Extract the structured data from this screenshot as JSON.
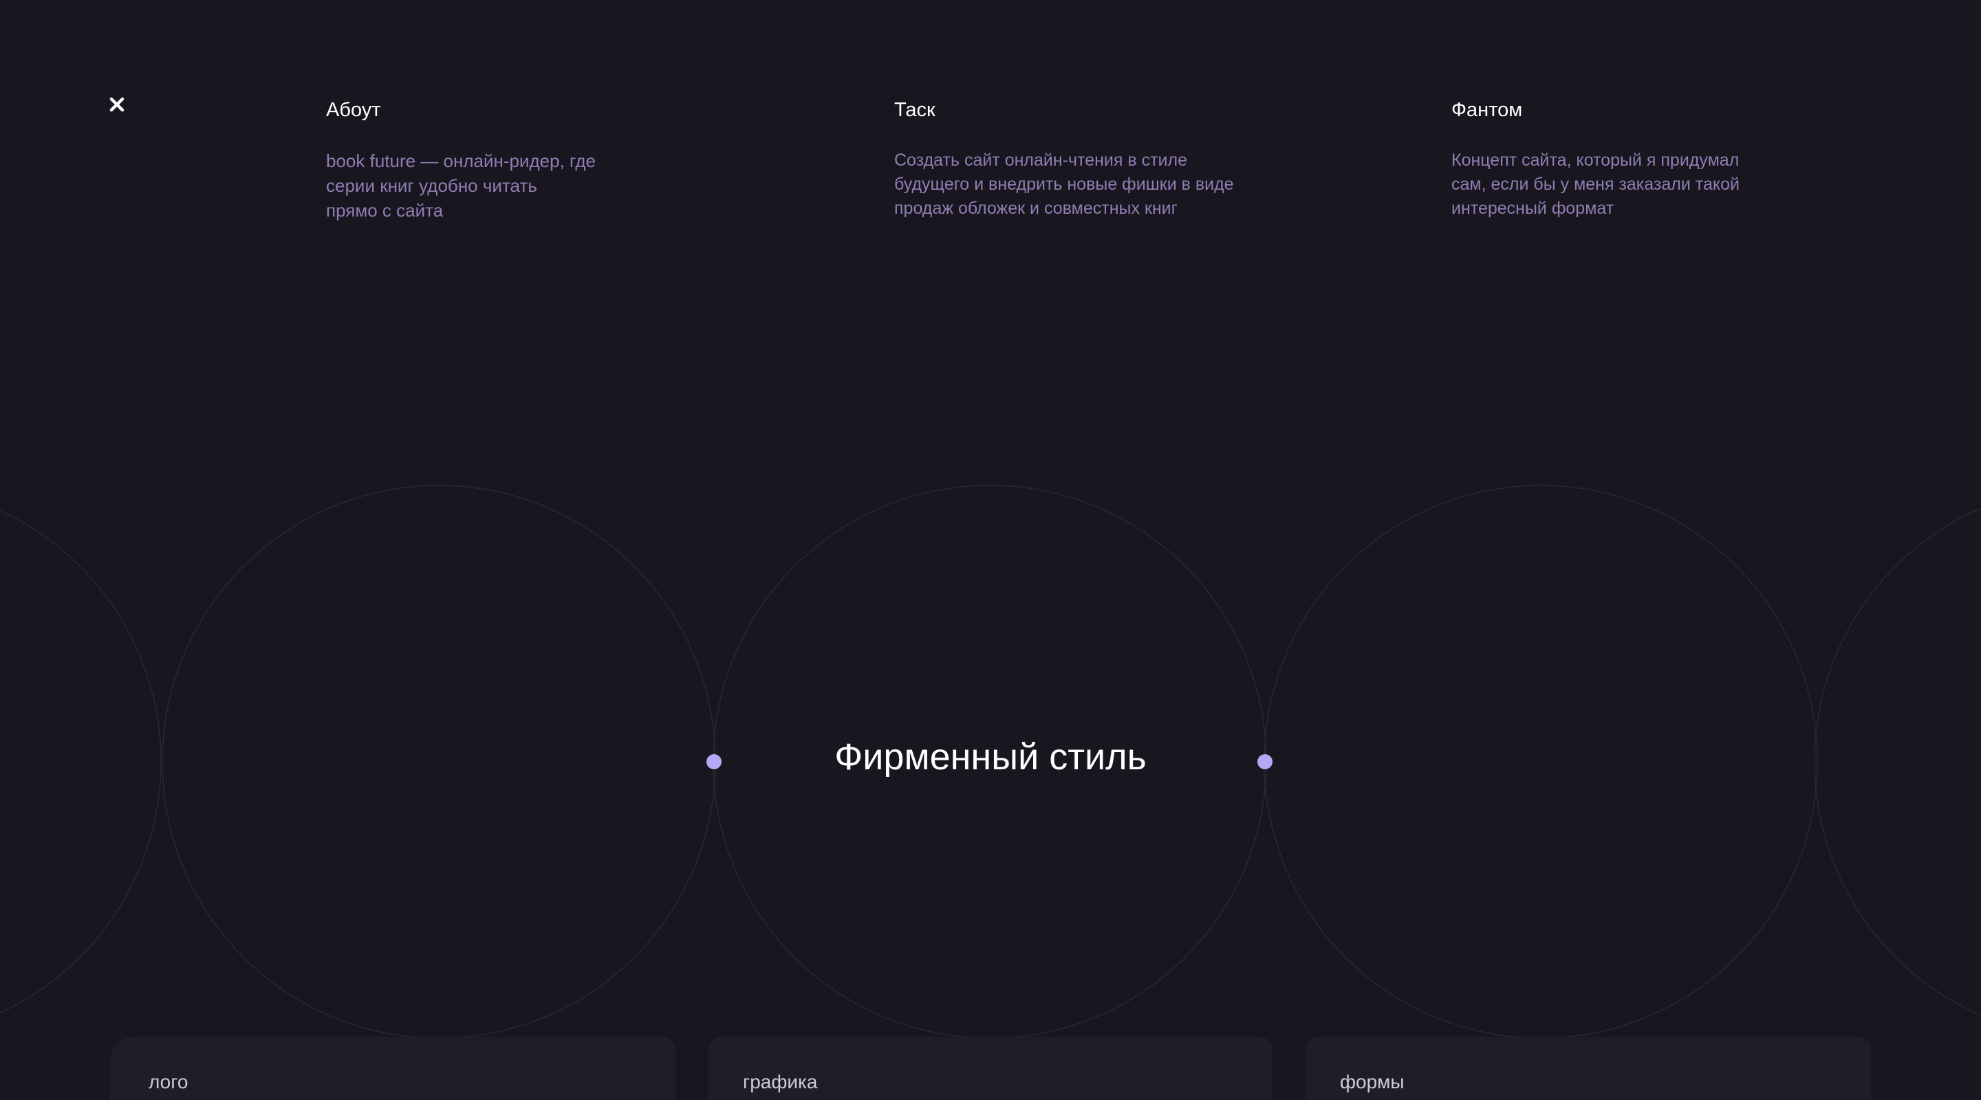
{
  "close": {
    "icon": "close-icon"
  },
  "info": {
    "about": {
      "title": "Абоут",
      "text": "book future — онлайн-ридер, где\nсерии книг удобно читать\nпрямо с сайта"
    },
    "task": {
      "title": "Таск",
      "text": "Создать сайт онлайн-чтения в стиле\nбудущего  и внедрить новые фишки в виде\nпродаж обложек и совместных книг"
    },
    "fantom": {
      "title": "Фантом",
      "text": "Концепт сайта, который я придумал\nсам, если бы у меня заказали такой\nинтересный формат"
    }
  },
  "hero": {
    "title": "Фирменный стиль"
  },
  "cards": [
    {
      "label": "лого"
    },
    {
      "label": "графика"
    },
    {
      "label": "формы"
    }
  ],
  "colors": {
    "background": "#19161f",
    "accent_dot": "#b7a8f5",
    "muted_text": "#8c7fb3",
    "circle_stroke": "#2b2734",
    "card_bg": "#201d27"
  }
}
